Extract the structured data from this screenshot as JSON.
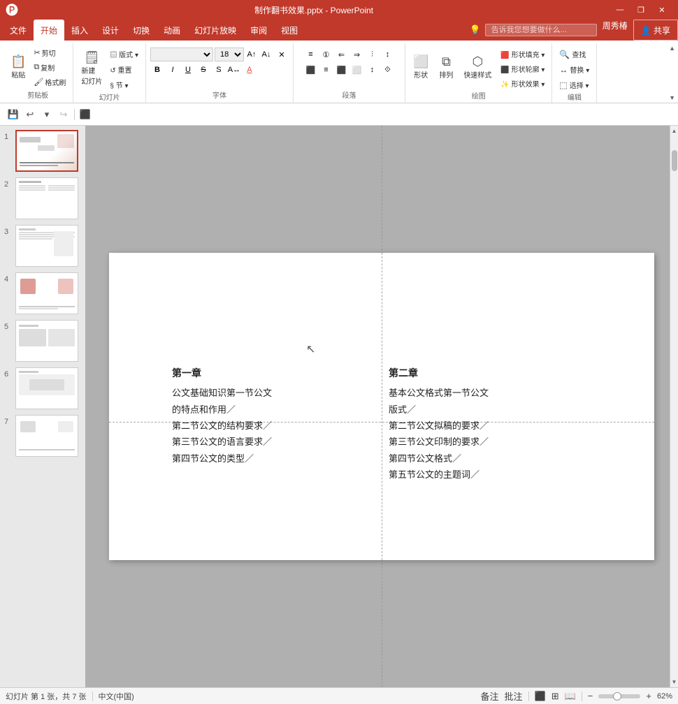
{
  "titlebar": {
    "title": "制作翻书效果.pptx - PowerPoint",
    "minimize": "—",
    "maximize": "□",
    "close": "✕",
    "restore": "❐"
  },
  "menubar": {
    "items": [
      "文件",
      "开始",
      "插入",
      "设计",
      "切换",
      "动画",
      "幻灯片放映",
      "审阅",
      "视图"
    ],
    "active": "开始",
    "search_placeholder": "告诉我您想要做什么...",
    "user": "周秀椿",
    "share": "共享"
  },
  "ribbon": {
    "groups": [
      {
        "name": "剪贴板",
        "buttons": [
          {
            "label": "粘贴",
            "icon": "📋"
          },
          {
            "label": "剪切",
            "icon": "✂"
          },
          {
            "label": "复制",
            "icon": "⧉"
          },
          {
            "label": "格式刷",
            "icon": "🖌"
          }
        ]
      },
      {
        "name": "幻灯片",
        "buttons": [
          {
            "label": "新建\n幻灯片",
            "icon": "🗒"
          },
          {
            "label": "版式▾",
            "icon": ""
          },
          {
            "label": "重置",
            "icon": ""
          },
          {
            "label": "节▾",
            "icon": ""
          }
        ]
      },
      {
        "name": "字体",
        "font_name": "",
        "font_size": "18",
        "bold": "B",
        "italic": "I",
        "underline": "U",
        "strike": "S",
        "shadow": "S",
        "font_color": "A"
      },
      {
        "name": "段落"
      },
      {
        "name": "绘图",
        "buttons": [
          {
            "label": "形状",
            "icon": "⬜"
          },
          {
            "label": "排列",
            "icon": "⧉"
          },
          {
            "label": "快速样式",
            "icon": "⬡"
          }
        ],
        "subitems": [
          "形状填充▾",
          "形状轮廓▾",
          "形状效果▾"
        ]
      },
      {
        "name": "编辑",
        "buttons": [
          {
            "label": "查找",
            "icon": "🔍"
          },
          {
            "label": "替换▾",
            "icon": "↔"
          },
          {
            "label": "选择▾",
            "icon": "⬚"
          }
        ]
      }
    ]
  },
  "quickbar": {
    "save": "💾",
    "undo": "↩",
    "redo": "↪",
    "customize": "⚙"
  },
  "slides": [
    {
      "num": 1,
      "active": true,
      "type": "cover"
    },
    {
      "num": 2,
      "active": false,
      "type": "toc"
    },
    {
      "num": 3,
      "active": false,
      "type": "content"
    },
    {
      "num": 4,
      "active": false,
      "type": "content2"
    },
    {
      "num": 5,
      "active": false,
      "type": "content3"
    },
    {
      "num": 6,
      "active": false,
      "type": "content4"
    },
    {
      "num": 7,
      "active": false,
      "type": "content5"
    }
  ],
  "canvas": {
    "slide_num": 1,
    "left_chapter": {
      "title": "第一章",
      "lines": [
        "公文基础知识第一节公文",
        "的特点和作用／",
        "第二节公文的结构要求／",
        "第三节公文的语言要求／",
        "第四节公文的类型／"
      ]
    },
    "right_chapter": {
      "title": "第二章",
      "lines": [
        "基本公文格式第一节公文",
        "版式／",
        "第二节公文拟稿的要求／",
        "第三节公文印制的要求／",
        "第四节公文格式／",
        "第五节公文的主题词／"
      ]
    }
  },
  "statusbar": {
    "slide_info": "幻灯片 第 1 张，共 7 张",
    "lang": "中文(中国)",
    "notes": "备注",
    "comments": "批注",
    "zoom": "62%",
    "view_normal": "▦",
    "view_slide": "⬛",
    "view_reading": "📖"
  }
}
